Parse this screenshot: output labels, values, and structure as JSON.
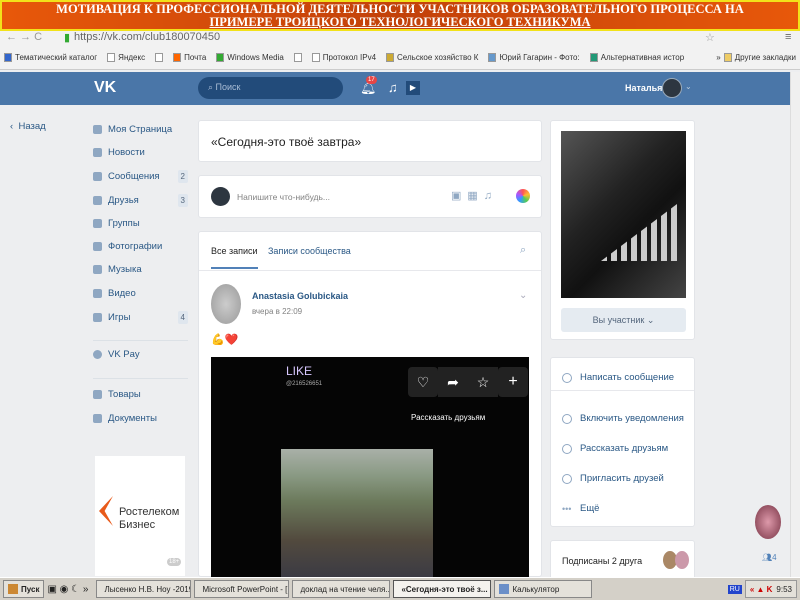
{
  "banner": {
    "line1": "МОТИВАЦИЯ К ПРОФЕССИОНАЛЬНОЙ ДЕЯТЕЛЬНОСТИ  УЧАСТНИКОВ ОБРАЗОВАТЕЛЬНОГО ПРОЦЕССА НА",
    "line2": "ПРИМЕРЕ  ТРОИЦКОГО ТЕХНОЛОГИЧЕСКОГО ТЕХНИКУМА"
  },
  "browser": {
    "url": "https://vk.com/club180070450",
    "bookmarks": [
      "Тематический каталог",
      "Яндекс",
      "",
      "Почта",
      "Windows Media",
      "",
      "Протокол IPv4",
      "Сельское хозяйство К",
      "Юрий Гагарин - Фото:",
      "Альтернативная истор"
    ],
    "other": "Другие закладки"
  },
  "header": {
    "logo": "VK",
    "search_placeholder": "Поиск",
    "notif_count": "17",
    "user": "Наталья"
  },
  "sidebar": {
    "back": "Назад",
    "items": [
      {
        "label": "Моя Страница"
      },
      {
        "label": "Новости"
      },
      {
        "label": "Сообщения",
        "count": "2"
      },
      {
        "label": "Друзья",
        "count": "3"
      },
      {
        "label": "Группы"
      },
      {
        "label": "Фотографии"
      },
      {
        "label": "Музыка"
      },
      {
        "label": "Видео"
      },
      {
        "label": "Игры",
        "count": "4"
      },
      {
        "label": "VK Pay"
      },
      {
        "label": "Товары"
      },
      {
        "label": "Документы"
      }
    ],
    "ad": {
      "brand1": "Ростелеком",
      "brand2": "Бизнес",
      "age": "18+"
    }
  },
  "main": {
    "title": "«Сегодня-это твоё завтра»",
    "post_placeholder": "Напишите что-нибудь...",
    "tabs": [
      "Все записи",
      "Записи сообщества"
    ],
    "post": {
      "author": "Anastasia Golubickaia",
      "time": "вчера в 22:09",
      "emoji": "💪❤️",
      "like_text": "LIKE",
      "like_id": "@216526651",
      "share_text": "Рассказать друзьям"
    }
  },
  "right": {
    "member_button": "Вы участник",
    "actions": [
      "Написать сообщение",
      "Включить уведомления",
      "Рассказать друзьям",
      "Пригласить друзей",
      "Ещё"
    ],
    "friends": "Подписаны 2 друга",
    "side_count": "4"
  },
  "taskbar": {
    "start": "Пуск",
    "items": [
      "Лысенко Н.В. Ноу -2019",
      "Microsoft PowerPoint - [...",
      "доклад на чтение челя...",
      "«Сегодня-это твоё з...",
      "Калькулятор"
    ],
    "lang": "RU",
    "time": "9:53"
  }
}
